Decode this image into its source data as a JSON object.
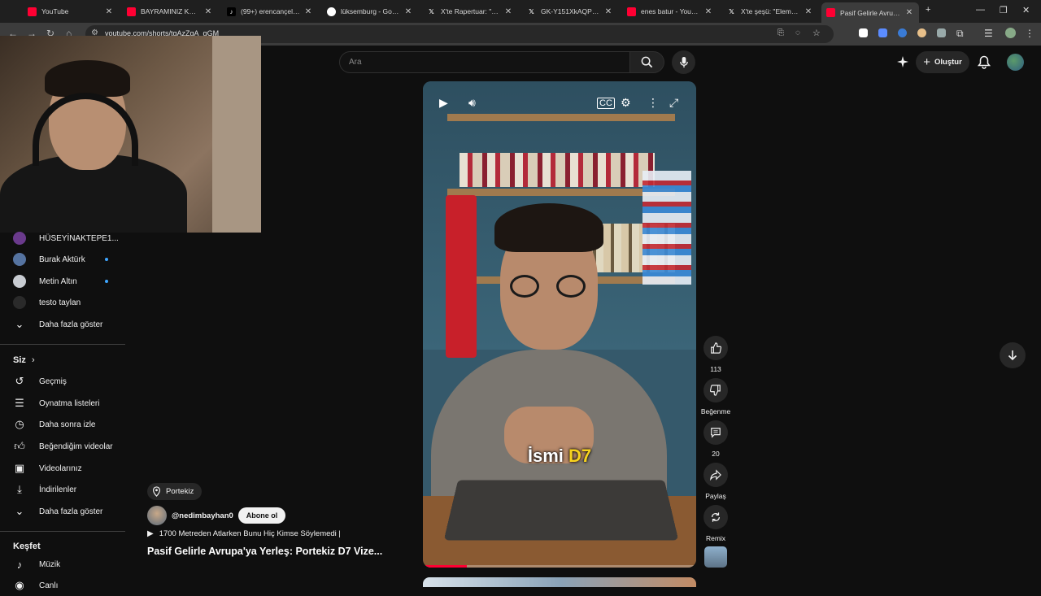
{
  "browser": {
    "tabs": [
      {
        "label": "YouTube",
        "favicon": "youtube-icon"
      },
      {
        "label": "BAYRAMINIZ KUTLU",
        "favicon": "youtube-icon"
      },
      {
        "label": "(99+) erencançelik (@",
        "favicon": "tiktok-icon"
      },
      {
        "label": "lüksemburg - Googl",
        "favicon": "google-icon"
      },
      {
        "label": "X'te Rapertuar: \"Joke",
        "favicon": "x-icon"
      },
      {
        "label": "GK-Y151XkAQP9NV (",
        "favicon": "x-icon"
      },
      {
        "label": "enes batur - YouTube",
        "favicon": "youtube-icon"
      },
      {
        "label": "X'te şeşü: \"Eleman fe",
        "favicon": "x-icon"
      },
      {
        "label": "Pasif Gelirle Avrupa'y",
        "favicon": "youtube-icon"
      }
    ],
    "url": "youtube.com/shorts/tgAzZgA_gGM"
  },
  "sidebar": {
    "subscriptions": [
      {
        "label": "HÜSEYİNAKTEPE1...",
        "new": false
      },
      {
        "label": "Burak Aktürk",
        "new": true
      },
      {
        "label": "Metin Altın",
        "new": true
      },
      {
        "label": "testo taylan",
        "new": false
      },
      {
        "label": "Daha fazla göster"
      }
    ],
    "you_heading": "Siz",
    "you_items": [
      {
        "label": "Geçmiş",
        "icon": "history-icon"
      },
      {
        "label": "Oynatma listeleri",
        "icon": "playlists-icon"
      },
      {
        "label": "Daha sonra izle",
        "icon": "watch-later-icon"
      },
      {
        "label": "Beğendiğim videolar",
        "icon": "liked-icon"
      },
      {
        "label": "Videolarınız",
        "icon": "your-videos-icon"
      },
      {
        "label": "İndirilenler",
        "icon": "downloads-icon"
      },
      {
        "label": "Daha fazla göster",
        "icon": "chevron-down-icon"
      }
    ],
    "explore_heading": "Keşfet",
    "explore_items": [
      {
        "label": "Müzik",
        "icon": "music-icon"
      },
      {
        "label": "Canlı",
        "icon": "live-icon"
      }
    ]
  },
  "header": {
    "search_placeholder": "Ara",
    "create_label": "Oluştur"
  },
  "short": {
    "caption_prefix": "İsmi",
    "caption_highlight": "D7",
    "progress": 0.16,
    "location": "Portekiz",
    "channel": "@nedimbayhan0",
    "subscribe_label": "Abone ol",
    "related": "1700 Metreden Atlarken Bunu Hiç Kimse Söylemedi |",
    "title": "Pasif Gelirle Avrupa'ya Yerleş: Portekiz D7 Vize..."
  },
  "actions": {
    "like_count": "113",
    "dislike_label": "Beğenme",
    "comment_count": "20",
    "share_label": "Paylaş",
    "remix_label": "Remix"
  },
  "colors": {
    "accent": "#ff0033",
    "background": "#0f0f0f",
    "caption_highlight": "#f7d21e"
  }
}
